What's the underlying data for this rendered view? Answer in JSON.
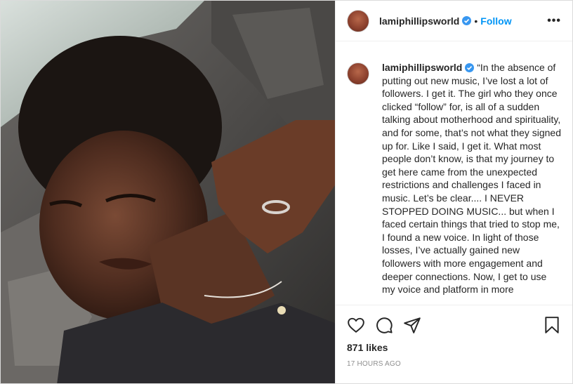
{
  "post": {
    "username": "lamiphillipsworld",
    "follow_label": "Follow",
    "more_label": "•••",
    "caption": "“In the absence of putting out new music, I’ve lost a lot of followers. I get it. The girl who they once clicked “follow” for, is all of a sudden talking about motherhood and spirituality, and for some, that’s not what they signed up for. Like I said, I get it. What most people don’t know, is that my journey to get here came from the unexpected restrictions and challenges I faced in music. Let’s be clear.... I NEVER STOPPED DOING MUSIC... but when I faced certain things that tried to stop me, I found a new voice. In light of those losses, I’ve actually gained new followers with more engagement and deeper connections. Now, I get to use my voice and platform in more",
    "likes": "871 likes",
    "timestamp": "17 HOURS AGO"
  },
  "icons": {
    "like": "heart-icon",
    "comment": "comment-icon",
    "share": "share-icon",
    "save": "bookmark-icon",
    "verified": "verified-badge-icon"
  },
  "colors": {
    "follow": "#0095f6",
    "verified": "#3897f0",
    "timestamp": "#8e8e8e"
  }
}
